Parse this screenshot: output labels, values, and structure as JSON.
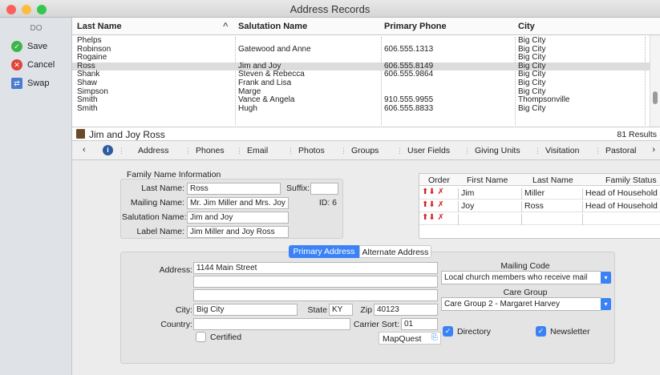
{
  "window": {
    "title": "Address Records"
  },
  "sidebar": {
    "header": "DO",
    "items": [
      {
        "label": "Save",
        "icon": "check-circle-icon",
        "color": "#3cb54a"
      },
      {
        "label": "Cancel",
        "icon": "x-circle-icon",
        "color": "#e0453b"
      },
      {
        "label": "Swap",
        "icon": "swap-icon",
        "color": "#4a7bd0"
      }
    ]
  },
  "table": {
    "columns": [
      "Last Name",
      "Salutation Name",
      "Primary Phone",
      "City"
    ],
    "sort_indicator": "^",
    "rows": [
      [
        "Phelps",
        "",
        "",
        "Big City"
      ],
      [
        "Robinson",
        "Gatewood and Anne",
        "606.555.1313",
        "Big City"
      ],
      [
        "Rogaine",
        "",
        "",
        "Big City"
      ],
      [
        "Ross",
        "Jim and Joy",
        "606.555.8149",
        "Big City"
      ],
      [
        "Shank",
        "Steven & Rebecca",
        "606.555.9864",
        "Big City"
      ],
      [
        "Shaw",
        "Frank and Lisa",
        "",
        "Big City"
      ],
      [
        "Simpson",
        "Marge",
        "",
        "Big City"
      ],
      [
        "Smith",
        "Vance & Angela",
        "910.555.9955",
        "Thompsonville"
      ],
      [
        "Smith",
        "Hugh",
        "606.555.8833",
        "Big City"
      ]
    ],
    "selected_index": 3
  },
  "record": {
    "name": "Jim and Joy Ross",
    "results": "81 Results"
  },
  "tabs": [
    "Address",
    "Phones",
    "Email",
    "Photos",
    "Groups",
    "User Fields",
    "Giving Units",
    "Visitation",
    "Pastoral"
  ],
  "active_tab": "Address",
  "family": {
    "group_title": "Family Name Information",
    "last_name_label": "Last Name:",
    "last_name": "Ross",
    "suffix_label": "Suffix:",
    "suffix": "",
    "mailing_label": "Mailing Name:",
    "mailing": "Mr. Jim Miller and Mrs. Joy",
    "id_label": "ID: 6",
    "salutation_label": "Salutation Name:",
    "salutation": "Jim and Joy",
    "label_label": "Label Name:",
    "label": "Jim Miller and Joy Ross"
  },
  "members": {
    "headers": [
      "Order",
      "First Name",
      "Last Name",
      "Family Status"
    ],
    "rows": [
      {
        "first": "Jim",
        "last": "Miller",
        "status": "Head of Household"
      },
      {
        "first": "Joy",
        "last": "Ross",
        "status": "Head of Household"
      },
      {
        "first": "",
        "last": "",
        "status": ""
      }
    ]
  },
  "address": {
    "tab_primary": "Primary Address",
    "tab_alternate": "Alternate Address",
    "address_label": "Address:",
    "line1": "1144 Main Street",
    "line2": "",
    "line3": "",
    "city_label": "City:",
    "city": "Big City",
    "state_label": "State",
    "state": "KY",
    "zip_label": "Zip",
    "zip": "40123",
    "country_label": "Country:",
    "country": "",
    "carrier_label": "Carrier Sort:",
    "carrier": "01",
    "certified_label": "Certified",
    "mapquest_label": "MapQuest",
    "mailing_code_label": "Mailing Code",
    "mailing_code": "Local church members who receive mail",
    "care_group_label": "Care Group",
    "care_group": "Care Group 2 - Margaret Harvey",
    "directory_label": "Directory",
    "newsletter_label": "Newsletter"
  },
  "colors": {
    "accent": "#3b82f6",
    "selection": "#dcdcdc"
  }
}
